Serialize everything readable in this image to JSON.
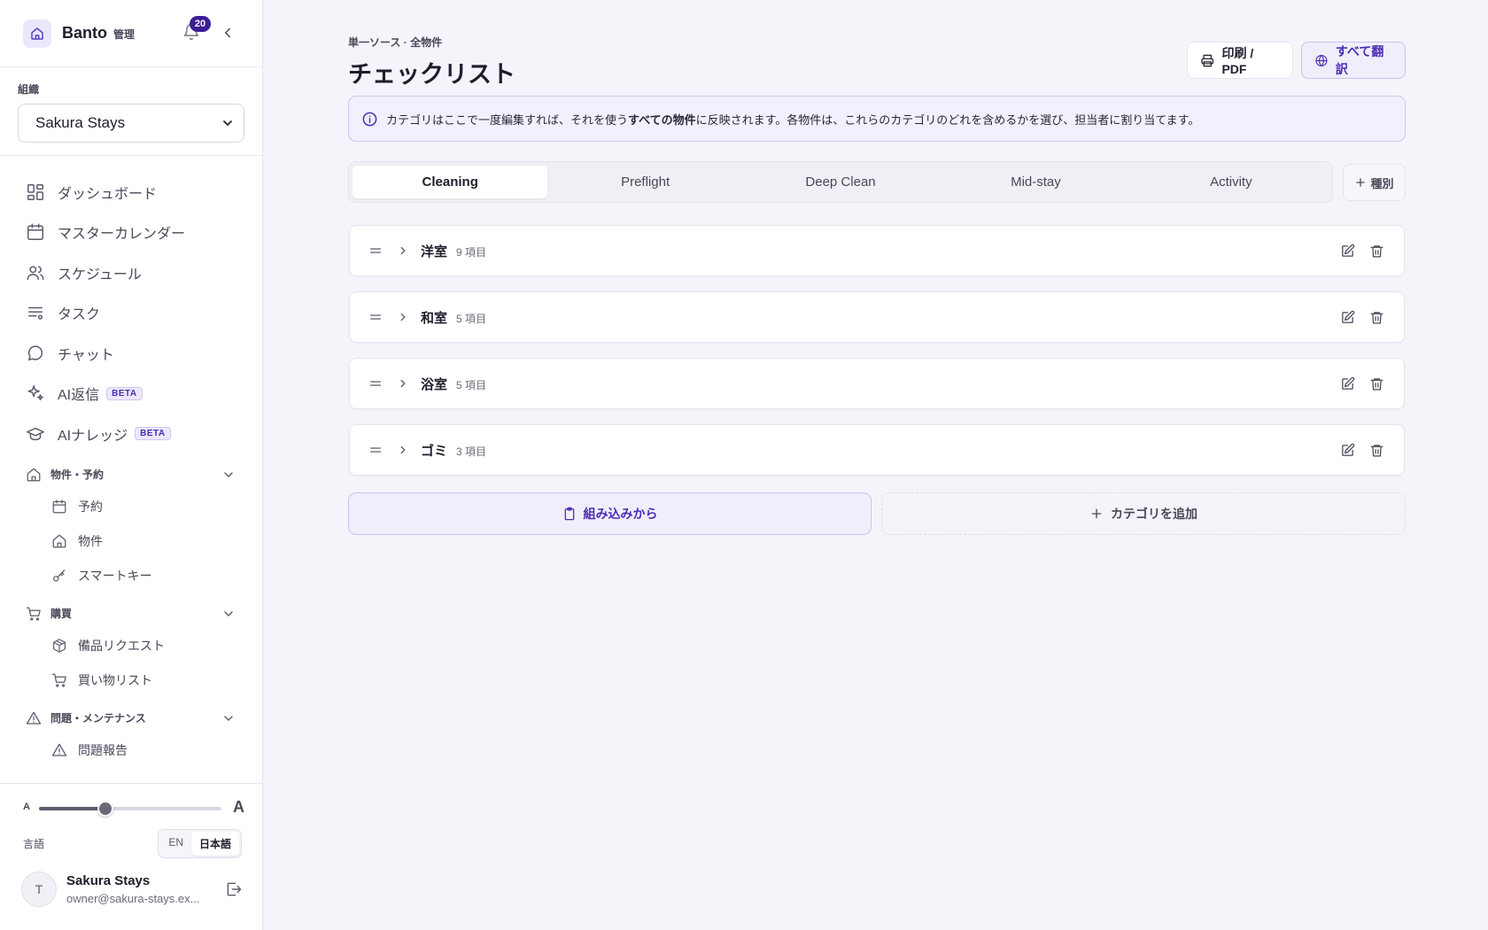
{
  "sidebar": {
    "brand_name": "Banto",
    "brand_sub": "管理",
    "notification_count": "20",
    "org_label": "組織",
    "org_selected": "Sakura Stays",
    "nav": [
      {
        "label": "ダッシュボード",
        "icon": "dashboard-icon"
      },
      {
        "label": "マスターカレンダー",
        "icon": "calendar-icon"
      },
      {
        "label": "スケジュール",
        "icon": "users-icon"
      },
      {
        "label": "タスク",
        "icon": "task-list-icon"
      },
      {
        "label": "チャット",
        "icon": "chat-icon"
      },
      {
        "label": "AI返信",
        "icon": "sparkles-icon",
        "badge": "BETA"
      },
      {
        "label": "AIナレッジ",
        "icon": "graduation-cap-icon",
        "badge": "BETA"
      }
    ],
    "sections": [
      {
        "label": "物件・予約",
        "icon": "home-icon",
        "items": [
          {
            "label": "予約",
            "icon": "calendar-icon"
          },
          {
            "label": "物件",
            "icon": "home-icon"
          },
          {
            "label": "スマートキー",
            "icon": "key-icon"
          }
        ]
      },
      {
        "label": "購買",
        "icon": "cart-icon",
        "items": [
          {
            "label": "備品リクエスト",
            "icon": "package-icon"
          },
          {
            "label": "買い物リスト",
            "icon": "cart-icon"
          }
        ]
      },
      {
        "label": "問題・メンテナンス",
        "icon": "warning-icon",
        "items": [
          {
            "label": "問題報告",
            "icon": "warning-icon"
          }
        ]
      }
    ],
    "font_size": {
      "small_label": "A",
      "large_label": "A",
      "level": 0.35
    },
    "language": {
      "label": "言語",
      "options": [
        "EN",
        "日本語"
      ],
      "selected": "日本語"
    },
    "user": {
      "initial": "T",
      "name": "Sakura Stays",
      "email": "owner@sakura-stays.ex..."
    }
  },
  "main": {
    "breadcrumb": "単一ソース · 全物件",
    "title": "チェックリスト",
    "print_label": "印刷 / PDF",
    "translate_label": "すべて翻訳",
    "info": {
      "before": "カテゴリはここで一度編集すれば、それを使う",
      "bold": "すべての物件",
      "after": "に反映されます。各物件は、これらのカテゴリのどれを含めるかを選び、担当者に割り当てます。"
    },
    "tabs": [
      "Cleaning",
      "Preflight",
      "Deep Clean",
      "Mid-stay",
      "Activity"
    ],
    "active_tab": "Cleaning",
    "add_type_label": "種別",
    "categories": [
      {
        "name": "洋室",
        "count": "9 項目"
      },
      {
        "name": "和室",
        "count": "5 項目"
      },
      {
        "name": "浴室",
        "count": "5 項目"
      },
      {
        "name": "ゴミ",
        "count": "3 項目"
      }
    ],
    "builtin_label": "組み込みから",
    "add_category_label": "カテゴリを追加"
  },
  "colors": {
    "accent": "#4b2db4",
    "badge": "#3d1d97",
    "background": "#f5f4fb"
  }
}
